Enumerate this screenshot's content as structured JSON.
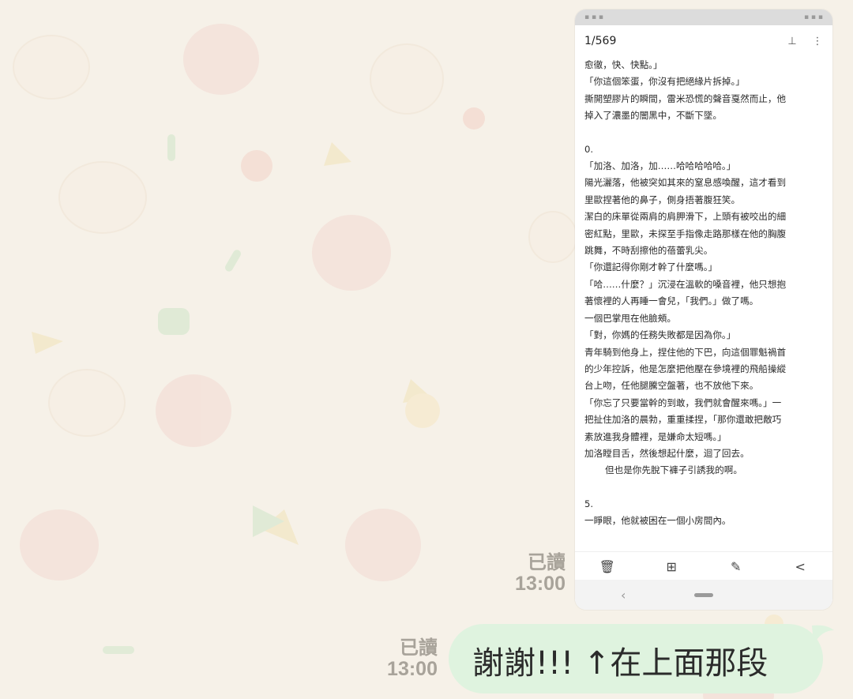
{
  "messages": [
    {
      "read_label": "已讀",
      "time": "13:00",
      "image": {
        "page_counter": "1/569",
        "pin_icon": "pin-icon",
        "more_icon": "more-vertical-icon",
        "lines": [
          "愈徹，快、快點。」",
          "「你這個笨蛋，你沒有把絕緣片拆掉。」",
          "撕開塑膠片的瞬間，雷米恐慌的聲音戛然而止，他",
          "掉入了濃墨的闇黑中，不斷下墜。",
          "",
          "0.",
          "「加洛、加洛，加……哈哈哈哈哈。」",
          "陽光灑落，他被突如其來的窒息感喚醒，這才看到",
          "里歐捏著他的鼻子，側身捂著腹狂笑。",
          "潔白的床單從兩肩的肩胛滑下，上頭有被咬出的細",
          "密紅點，里歐，未探至手指像走路那樣在他的胸腹",
          "跳舞，不時刮擦他的蓓蕾乳尖。",
          "「你還記得你剛才幹了什麼嗎。」",
          "「哈……什麼？」沉浸在溫軟的嗓音裡，他只想抱",
          "著懷裡的人再睡一會兒，「我們。」做了嗎。",
          "一個巴掌甩在他臉頰。",
          "「對，你媽的任務失敗都是因為你。」",
          "青年騎到他身上，捏住他的下巴，向這個罪魁禍首",
          "的少年控訴，他是怎麼把他壓在參境裡的飛船操縱",
          "台上吻，任他腿騰空盤著，也不放他下來。",
          "「你忘了只要當幹的到敢，我們就會醒來嗎。」一",
          "把扯住加洛的晨勃，重重揉捏，「那你還敢把敵巧",
          "素放進我身體裡，是嫌命太短嗎。」",
          "加洛瞠目舌，然後想起什麼，迴了回去。",
          "但也是你先脫下褲子引誘我的啊。",
          "",
          "5.",
          "一睜眼，他就被困在一個小房間內。"
        ],
        "toolbar_icons": [
          "trash-icon",
          "add-box-icon",
          "edit-icon",
          "share-icon"
        ],
        "nav_back": "‹"
      }
    },
    {
      "read_label": "已讀",
      "time": "13:00",
      "text": "謝謝!!! ↑在上面那段"
    }
  ]
}
